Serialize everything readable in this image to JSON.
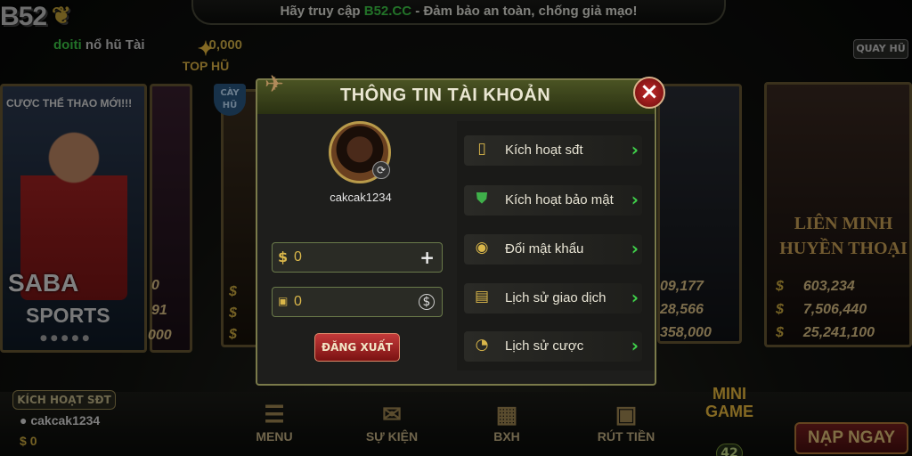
{
  "topbar": {
    "prefix": "Hãy truy cập ",
    "domain": "B52.CC",
    "suffix": " - Đảm bảo an toàn, chống giả mạo!"
  },
  "logo": {
    "text": "B52"
  },
  "ticker": {
    "user": "doiti",
    "text": " nổ hũ Tài",
    "amount": "0,000"
  },
  "tophu": {
    "label": "TOP HŨ"
  },
  "cayhu": {
    "label": "CÀY HŨ"
  },
  "quayhu": {
    "label": "QUAY HŨ"
  },
  "card_saba": {
    "title": "CƯỢC THỂ THAO MỚI!!!",
    "brand": "SABA",
    "sub": "SPORTS"
  },
  "card_lienminh": {
    "line1": "LIÊN MINH",
    "line2": "HUYỀN THOẠI",
    "jackpots": [
      "603,234",
      "7,506,440",
      "25,241,100"
    ]
  },
  "card_metal": {
    "jackpots": [
      "09,177",
      "28,566",
      "358,000"
    ]
  },
  "card_mid": {
    "jackpots": [
      "0",
      "91",
      "000"
    ]
  },
  "modal": {
    "title": "THÔNG TIN TÀI KHOẢN",
    "username": "cakcak1234",
    "gold_balance": "0",
    "silver_balance": "0",
    "logout_label": "ĐĂNG XUẤT",
    "menu": [
      {
        "label": "Kích hoạt sđt",
        "icon": "phone-icon"
      },
      {
        "label": "Kích hoạt bảo mật",
        "icon": "shield-icon"
      },
      {
        "label": "Đổi mật khẩu",
        "icon": "lock-icon"
      },
      {
        "label": "Lịch sử giao dịch",
        "icon": "receipt-icon"
      },
      {
        "label": "Lịch sử cược",
        "icon": "stopwatch-icon"
      }
    ]
  },
  "bottom": {
    "activate_phone": "KÍCH HOẠT SĐT",
    "username": "cakcak1234",
    "balance": "0",
    "nav": [
      {
        "label": "MENU",
        "icon": "menu-icon"
      },
      {
        "label": "SỰ KIỆN",
        "icon": "event-icon"
      },
      {
        "label": "BXH",
        "icon": "ranking-icon"
      },
      {
        "label": "RÚT TIỀN",
        "icon": "withdraw-icon"
      }
    ],
    "minigame_label": "MINI GAME",
    "minigame_count": "42",
    "topup_label": "NẠP NGAY"
  }
}
